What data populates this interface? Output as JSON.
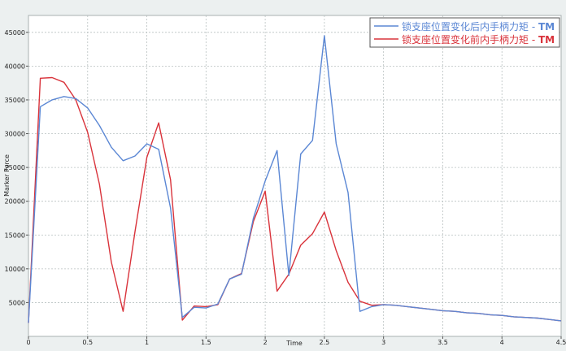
{
  "chart_data": {
    "type": "line",
    "xlabel": "Time",
    "ylabel": "Marker Force",
    "xlim": [
      0,
      4.5
    ],
    "ylim": [
      0,
      47500
    ],
    "x_ticks": [
      0,
      0.5,
      1,
      1.5,
      2,
      2.5,
      3,
      3.5,
      4,
      4.5
    ],
    "x_tick_labels": [
      "0",
      "0.5",
      "1",
      "1.5",
      "2",
      "2.5",
      "3",
      "3.5",
      "4",
      "4.5"
    ],
    "y_ticks": [
      5000,
      10000,
      15000,
      20000,
      25000,
      30000,
      35000,
      40000,
      45000
    ],
    "y_tick_labels": [
      "5000",
      "10000",
      "15000",
      "20000",
      "25000",
      "30000",
      "35000",
      "40000",
      "45000"
    ],
    "grid": true,
    "legend_position": "top-right",
    "series": [
      {
        "name": "锁支座位置变化后内手柄力矩",
        "tag": "TM",
        "color": "#5b87d4",
        "points": [
          [
            0,
            2000
          ],
          [
            0.1,
            34000
          ],
          [
            0.2,
            35000
          ],
          [
            0.3,
            35500
          ],
          [
            0.4,
            35200
          ],
          [
            0.5,
            33800
          ],
          [
            0.6,
            31200
          ],
          [
            0.7,
            28000
          ],
          [
            0.8,
            26000
          ],
          [
            0.9,
            26700
          ],
          [
            1.0,
            28500
          ],
          [
            1.1,
            27700
          ],
          [
            1.2,
            19000
          ],
          [
            1.3,
            2800
          ],
          [
            1.4,
            4300
          ],
          [
            1.5,
            4200
          ],
          [
            1.6,
            4800
          ],
          [
            1.7,
            8500
          ],
          [
            1.8,
            9200
          ],
          [
            1.9,
            17500
          ],
          [
            2.0,
            23000
          ],
          [
            2.1,
            27500
          ],
          [
            2.2,
            9000
          ],
          [
            2.3,
            27000
          ],
          [
            2.4,
            29000
          ],
          [
            2.5,
            44500
          ],
          [
            2.6,
            28500
          ],
          [
            2.7,
            21300
          ],
          [
            2.8,
            3700
          ],
          [
            2.9,
            4400
          ],
          [
            3.0,
            4700
          ],
          [
            3.1,
            4600
          ],
          [
            3.2,
            4400
          ],
          [
            3.3,
            4200
          ],
          [
            3.4,
            4000
          ],
          [
            3.5,
            3800
          ],
          [
            3.6,
            3700
          ],
          [
            3.7,
            3500
          ],
          [
            3.8,
            3400
          ],
          [
            3.9,
            3200
          ],
          [
            4.0,
            3100
          ],
          [
            4.1,
            2900
          ],
          [
            4.2,
            2800
          ],
          [
            4.3,
            2700
          ],
          [
            4.4,
            2500
          ],
          [
            4.5,
            2300
          ]
        ]
      },
      {
        "name": "锁支座位置变化前内手柄力矩",
        "tag": "TM",
        "color": "#d9333b",
        "points": [
          [
            0,
            2000
          ],
          [
            0.1,
            38200
          ],
          [
            0.2,
            38300
          ],
          [
            0.3,
            37600
          ],
          [
            0.4,
            35000
          ],
          [
            0.5,
            30200
          ],
          [
            0.6,
            22500
          ],
          [
            0.7,
            11000
          ],
          [
            0.8,
            3700
          ],
          [
            0.9,
            15500
          ],
          [
            1.0,
            26500
          ],
          [
            1.1,
            31600
          ],
          [
            1.2,
            23200
          ],
          [
            1.3,
            2400
          ],
          [
            1.4,
            4500
          ],
          [
            1.5,
            4400
          ],
          [
            1.6,
            4700
          ],
          [
            1.7,
            8500
          ],
          [
            1.8,
            9300
          ],
          [
            1.9,
            17000
          ],
          [
            2.0,
            21500
          ],
          [
            2.1,
            6700
          ],
          [
            2.2,
            9200
          ],
          [
            2.3,
            13500
          ],
          [
            2.4,
            15200
          ],
          [
            2.5,
            18400
          ],
          [
            2.6,
            12700
          ],
          [
            2.7,
            8000
          ],
          [
            2.8,
            5200
          ],
          [
            2.9,
            4600
          ],
          [
            3.0,
            4700
          ],
          [
            3.1,
            4600
          ],
          [
            3.2,
            4400
          ],
          [
            3.3,
            4200
          ],
          [
            3.4,
            4000
          ],
          [
            3.5,
            3800
          ],
          [
            3.6,
            3700
          ],
          [
            3.7,
            3500
          ],
          [
            3.8,
            3400
          ],
          [
            3.9,
            3200
          ],
          [
            4.0,
            3100
          ],
          [
            4.1,
            2900
          ],
          [
            4.2,
            2800
          ],
          [
            4.3,
            2700
          ],
          [
            4.4,
            2500
          ],
          [
            4.5,
            2300
          ]
        ]
      }
    ]
  }
}
